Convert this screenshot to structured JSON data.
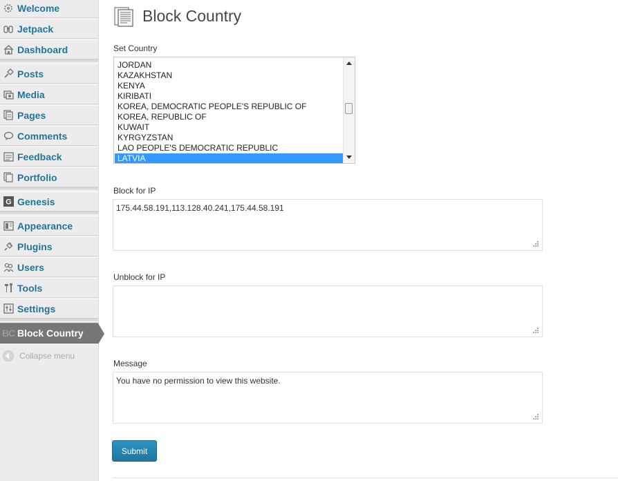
{
  "sidebar": {
    "items": [
      {
        "label": "Welcome",
        "icon": "gear-icon"
      },
      {
        "label": "Jetpack",
        "icon": "jetpack-icon"
      },
      {
        "label": "Dashboard",
        "icon": "home-icon"
      },
      {
        "label": "Posts",
        "icon": "pin-icon"
      },
      {
        "label": "Media",
        "icon": "media-icon"
      },
      {
        "label": "Pages",
        "icon": "pages-icon"
      },
      {
        "label": "Comments",
        "icon": "comment-icon"
      },
      {
        "label": "Feedback",
        "icon": "feedback-icon"
      },
      {
        "label": "Portfolio",
        "icon": "portfolio-icon"
      },
      {
        "label": "Genesis",
        "icon": "genesis-icon"
      },
      {
        "label": "Appearance",
        "icon": "appearance-icon"
      },
      {
        "label": "Plugins",
        "icon": "plugin-icon"
      },
      {
        "label": "Users",
        "icon": "users-icon"
      },
      {
        "label": "Tools",
        "icon": "tools-icon"
      },
      {
        "label": "Settings",
        "icon": "settings-icon"
      },
      {
        "label": "Block Country",
        "icon": "block-country-icon",
        "logo_text": "BC"
      }
    ],
    "collapse_label": "Collapse menu"
  },
  "page": {
    "title": "Block Country"
  },
  "form": {
    "country_label": "Set Country",
    "countries": [
      "JORDAN",
      "KAZAKHSTAN",
      "KENYA",
      "KIRIBATI",
      "KOREA, DEMOCRATIC PEOPLE'S REPUBLIC OF",
      "KOREA, REPUBLIC OF",
      "KUWAIT",
      "KYRGYZSTAN",
      "LAO PEOPLE'S DEMOCRATIC REPUBLIC",
      "LATVIA"
    ],
    "selected_country": "LATVIA",
    "block_ip_label": "Block for IP",
    "block_ip_value": "175.44.58.191,113.128.40.241,175.44.58.191",
    "unblock_ip_label": "Unblock for IP",
    "unblock_ip_value": "",
    "message_label": "Message",
    "message_value": "You have no permission to view this website.",
    "submit_label": "Submit"
  },
  "colors": {
    "link": "#21759b",
    "active_menu": "#777777",
    "selected_option": "#3399ff",
    "button": "#21759b"
  }
}
